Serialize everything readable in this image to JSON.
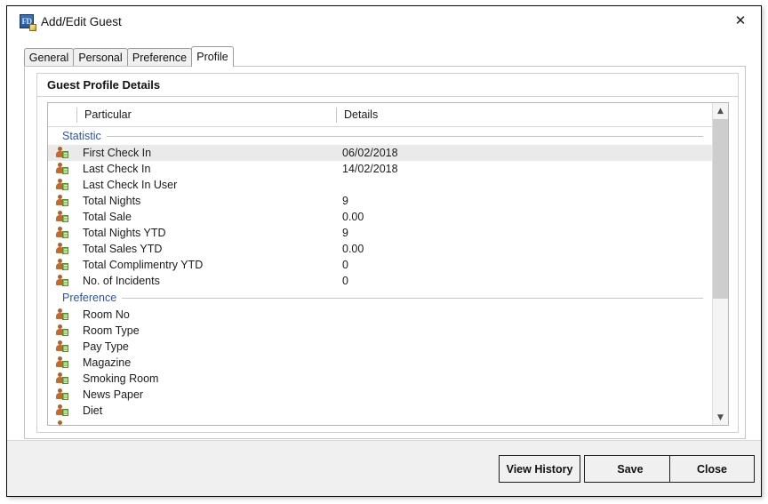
{
  "window": {
    "title": "Add/Edit Guest",
    "icon": "app-fd-icon",
    "close_icon": "close-icon"
  },
  "tabs": [
    {
      "label": "General",
      "active": false
    },
    {
      "label": "Personal",
      "active": false
    },
    {
      "label": "Preference",
      "active": false
    },
    {
      "label": "Profile",
      "active": true
    }
  ],
  "group": {
    "title": "Guest Profile Details"
  },
  "grid": {
    "columns": [
      "",
      "Particular",
      "Details"
    ],
    "sections": [
      {
        "name": "Statistic",
        "rows": [
          {
            "particular": "First Check In",
            "details": "06/02/2018",
            "selected": true
          },
          {
            "particular": "Last Check In",
            "details": "14/02/2018",
            "selected": false
          },
          {
            "particular": "Last Check In User",
            "details": "",
            "selected": false
          },
          {
            "particular": "Total Nights",
            "details": "9",
            "selected": false
          },
          {
            "particular": "Total Sale",
            "details": "0.00",
            "selected": false
          },
          {
            "particular": "Total Nights YTD",
            "details": "9",
            "selected": false
          },
          {
            "particular": "Total Sales YTD",
            "details": "0.00",
            "selected": false
          },
          {
            "particular": "Total Complimentry YTD",
            "details": "0",
            "selected": false
          },
          {
            "particular": "No. of Incidents",
            "details": "0",
            "selected": false
          }
        ]
      },
      {
        "name": "Preference",
        "rows": [
          {
            "particular": "Room No",
            "details": "",
            "selected": false
          },
          {
            "particular": "Room Type",
            "details": "",
            "selected": false
          },
          {
            "particular": "Pay Type",
            "details": "",
            "selected": false
          },
          {
            "particular": "Magazine",
            "details": "",
            "selected": false
          },
          {
            "particular": "Smoking Room",
            "details": "",
            "selected": false
          },
          {
            "particular": "News Paper",
            "details": "",
            "selected": false
          },
          {
            "particular": "Diet",
            "details": "",
            "selected": false
          },
          {
            "particular": "",
            "details": "",
            "selected": false
          }
        ]
      }
    ]
  },
  "scrollbar": {
    "up_icon": "chevron-up-icon",
    "down_icon": "chevron-down-icon"
  },
  "footer": {
    "buttons": [
      {
        "label": "View History"
      },
      {
        "label": "Save"
      },
      {
        "label": "Close"
      }
    ]
  },
  "colors": {
    "section_text": "#2a55a8",
    "selection": "#eaeaea",
    "footer_bg": "#f0f0f0"
  }
}
